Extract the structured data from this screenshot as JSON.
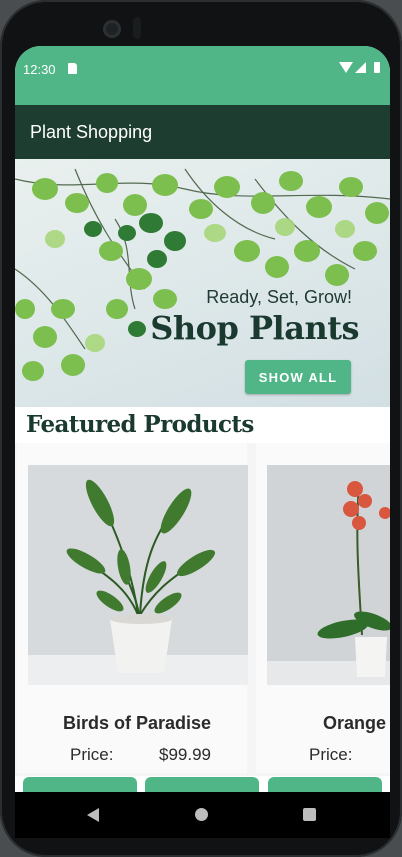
{
  "status_bar": {
    "time": "12:30"
  },
  "app_bar": {
    "title": "Plant Shopping"
  },
  "hero": {
    "subtitle": "Ready, Set, Grow!",
    "title": "Shop Plants",
    "button_label": "SHOW ALL"
  },
  "featured": {
    "heading": "Featured Products",
    "products": [
      {
        "name": "Birds of Paradise",
        "price_label": "Price:",
        "price": "$99.99"
      },
      {
        "name": "Orange Phal",
        "price_label": "Price:",
        "price": ""
      }
    ]
  },
  "colors": {
    "status_bar": "#50b687",
    "app_bar": "#1d3d30",
    "accent": "#50b687",
    "heading": "#1b3a2f"
  }
}
